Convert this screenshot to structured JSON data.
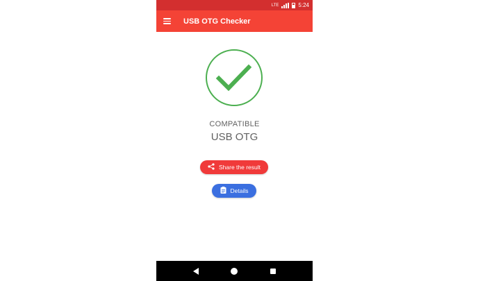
{
  "status_bar": {
    "network_label": "LTE",
    "time": "5:24"
  },
  "app_bar": {
    "title": "USB OTG Checker",
    "menu_icon": "menu-icon"
  },
  "result": {
    "icon": "check-circle-icon",
    "line1": "COMPATIBLE",
    "line2": "USB OTG",
    "check_color": "#4caf50"
  },
  "actions": {
    "share_label": "Share the result",
    "share_icon": "share-icon",
    "share_color": "#f03a3a",
    "details_label": "Details",
    "details_icon": "clipboard-icon",
    "details_color": "#3b6fe0"
  },
  "colors": {
    "status_bar": "#d32f2f",
    "app_bar": "#f44336",
    "nav_bar": "#000000"
  },
  "nav_bar": {
    "back_icon": "back-icon",
    "home_icon": "home-icon",
    "recent_icon": "recent-apps-icon"
  }
}
